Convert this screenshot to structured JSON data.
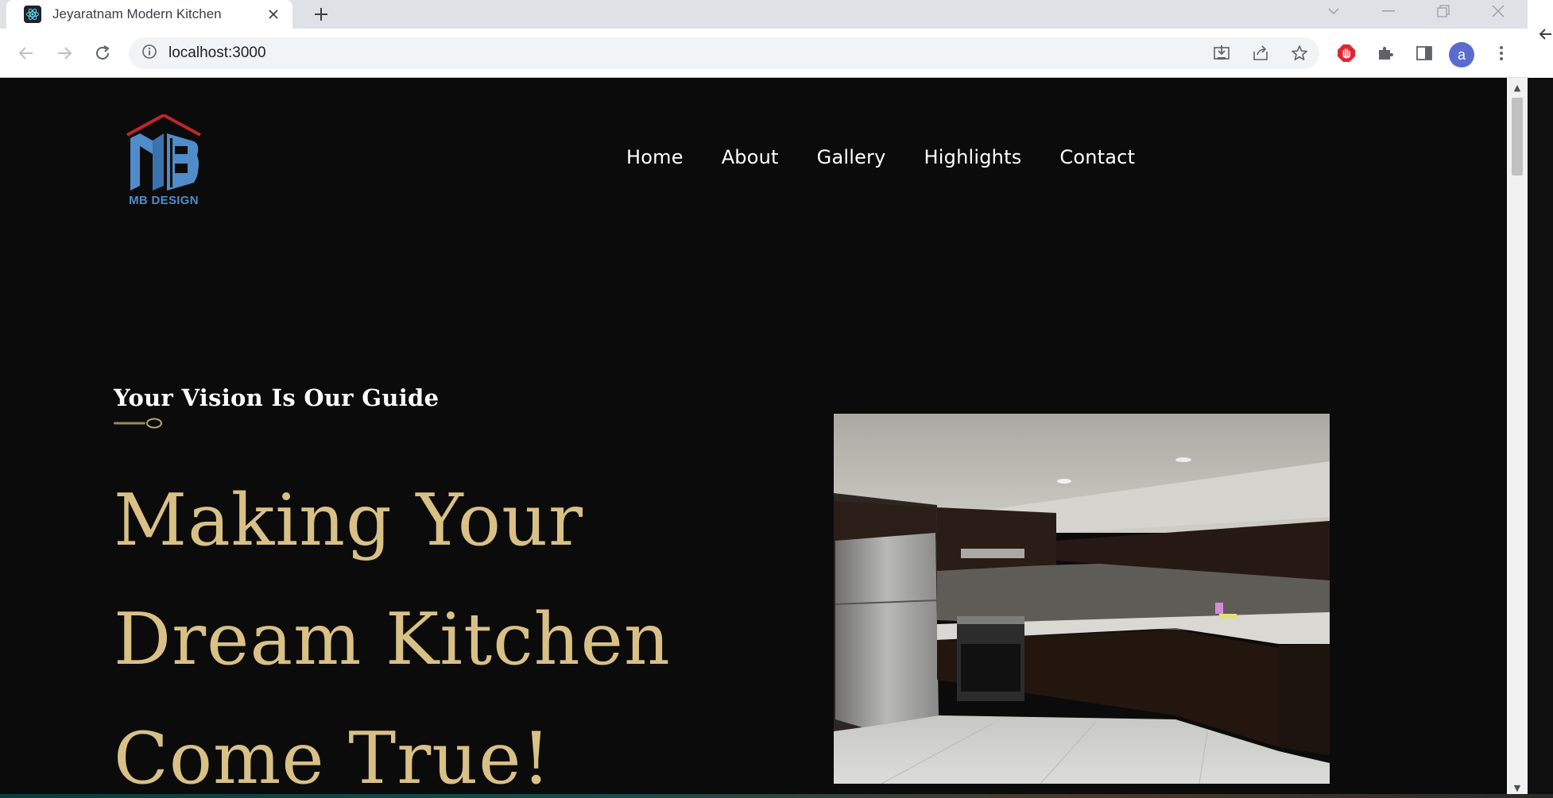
{
  "browser": {
    "tab_title": "Jeyaratnam Modern Kitchen",
    "url": "localhost:3000",
    "profile_initial": "a",
    "favicon": "react-icon"
  },
  "site": {
    "logo_text": "MB DESIGN",
    "nav": [
      "Home",
      "About",
      "Gallery",
      "Highlights",
      "Contact"
    ],
    "tagline": "Your Vision Is Our Guide",
    "hero_lines": [
      "Making Your",
      "Dream Kitchen",
      "Come True!"
    ]
  },
  "colors": {
    "background": "#0b0b0b",
    "hero_gold": "#d9c085",
    "logo_blue": "#4f8cc9",
    "logo_roof_red": "#c0262d"
  }
}
